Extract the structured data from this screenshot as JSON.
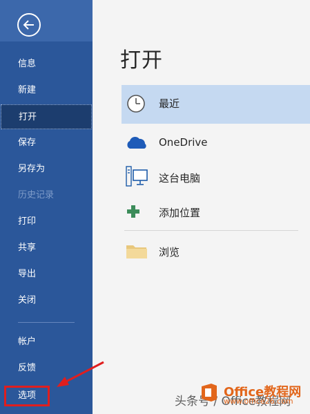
{
  "sidebar": {
    "back_icon": "back-arrow-icon",
    "items": [
      {
        "label": "信息",
        "state": "normal"
      },
      {
        "label": "新建",
        "state": "normal"
      },
      {
        "label": "打开",
        "state": "active"
      },
      {
        "label": "保存",
        "state": "normal"
      },
      {
        "label": "另存为",
        "state": "normal"
      },
      {
        "label": "历史记录",
        "state": "disabled"
      },
      {
        "label": "打印",
        "state": "normal"
      },
      {
        "label": "共享",
        "state": "normal"
      },
      {
        "label": "导出",
        "state": "normal"
      },
      {
        "label": "关闭",
        "state": "normal"
      }
    ],
    "bottom_items": [
      {
        "label": "帐户"
      },
      {
        "label": "反馈"
      },
      {
        "label": "选项"
      }
    ]
  },
  "main": {
    "title": "打开",
    "locations": [
      {
        "label": "最近",
        "icon": "clock-icon",
        "selected": true
      },
      {
        "label": "OneDrive",
        "icon": "cloud-icon",
        "selected": false
      },
      {
        "label": "这台电脑",
        "icon": "computer-icon",
        "selected": false
      },
      {
        "label": "添加位置",
        "icon": "plus-icon",
        "selected": false
      },
      {
        "label": "浏览",
        "icon": "folder-icon",
        "selected": false
      }
    ]
  },
  "watermark": {
    "text": "头条号 / Office教程网",
    "brand": "Office教程网",
    "url": "www.office26.com"
  },
  "colors": {
    "sidebar_bg": "#2b579a",
    "sidebar_active": "#1c3d6e",
    "selected_location": "#c5d9f1",
    "annotation_red": "#e01e1e",
    "brand_orange": "#e2661b"
  }
}
